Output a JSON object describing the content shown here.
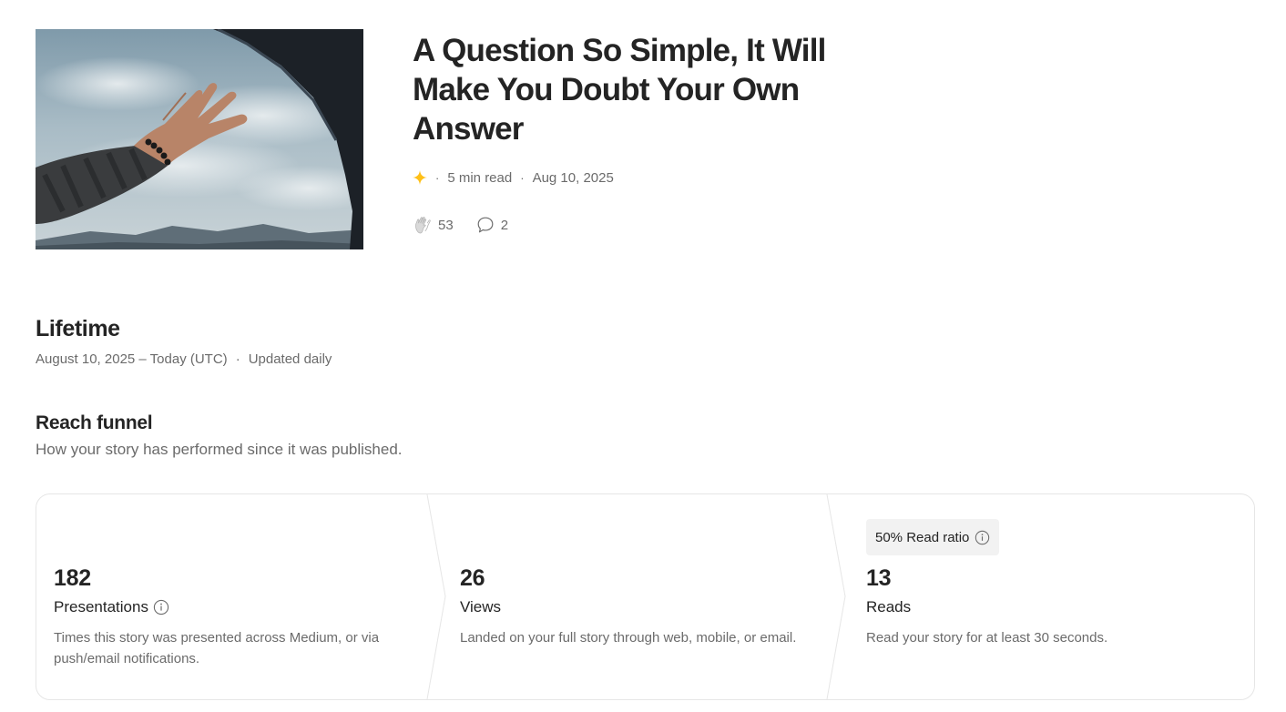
{
  "story": {
    "title": "A Question So Simple, It Will Make You Doubt Your Own Answer",
    "read_time": "5 min read",
    "published": "Aug 10, 2025",
    "claps": "53",
    "responses": "2",
    "member_star_color": "#ffc017",
    "image_icon": "hand-out-of-car-window-photo"
  },
  "lifetime": {
    "heading": "Lifetime",
    "range": "August 10, 2025 – Today (UTC)",
    "update_note": "Updated daily"
  },
  "funnel": {
    "heading": "Reach funnel",
    "subtitle": "How your story has performed since it was published.",
    "read_ratio": "50% Read ratio",
    "stages": [
      {
        "value": "182",
        "label": "Presentations",
        "description": "Times this story was presented across Medium, or via push/email notifications."
      },
      {
        "value": "26",
        "label": "Views",
        "description": "Landed on your full story through web, mobile, or email."
      },
      {
        "value": "13",
        "label": "Reads",
        "description": "Read your story for at least 30 seconds."
      }
    ]
  }
}
